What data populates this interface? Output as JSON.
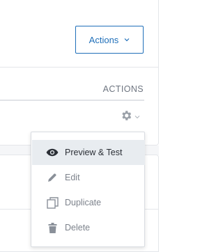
{
  "header": {
    "actions_label": "Actions"
  },
  "table": {
    "column_actions": "ACTIONS"
  },
  "row_menu": {
    "items": [
      {
        "label": "Preview & Test",
        "icon": "eye-icon",
        "active": true
      },
      {
        "label": "Edit",
        "icon": "pencil-icon",
        "active": false
      },
      {
        "label": "Duplicate",
        "icon": "duplicate-icon",
        "active": false
      },
      {
        "label": "Delete",
        "icon": "trash-icon",
        "active": false
      }
    ]
  },
  "colors": {
    "accent": "#1f6fb9",
    "menu_active_bg": "#e8ecf0",
    "muted_text": "#7d838c"
  }
}
